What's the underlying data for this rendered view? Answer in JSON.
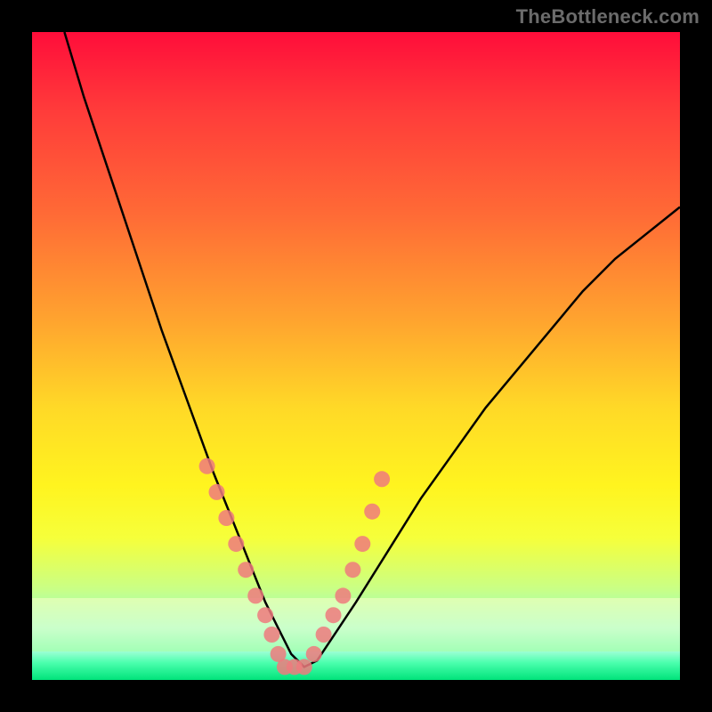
{
  "watermark": "TheBottleneck.com",
  "chart_data": {
    "type": "line",
    "title": "",
    "xlabel": "",
    "ylabel": "",
    "xlim": [
      0,
      100
    ],
    "ylim": [
      0,
      100
    ],
    "grid": false,
    "legend": false,
    "curve_color": "#000000",
    "marker_color": "#ee7a7e",
    "series": [
      {
        "name": "bottleneck-curve",
        "x": [
          5,
          8,
          12,
          16,
          20,
          24,
          28,
          30,
          32,
          34,
          36,
          38,
          40,
          42,
          44,
          46,
          50,
          55,
          60,
          65,
          70,
          75,
          80,
          85,
          90,
          95,
          100
        ],
        "y": [
          100,
          90,
          78,
          66,
          54,
          43,
          32,
          27,
          22,
          17,
          12,
          8,
          4,
          2,
          3,
          6,
          12,
          20,
          28,
          35,
          42,
          48,
          54,
          60,
          65,
          69,
          73
        ]
      }
    ],
    "markers": {
      "name": "sample-points",
      "x": [
        27,
        28.5,
        30,
        31.5,
        33,
        34.5,
        36,
        37,
        38,
        39,
        40.5,
        42,
        43.5,
        45,
        46.5,
        48,
        49.5,
        51,
        52.5,
        54
      ],
      "y": [
        33,
        29,
        25,
        21,
        17,
        13,
        10,
        7,
        4,
        2,
        2,
        2,
        4,
        7,
        10,
        13,
        17,
        21,
        26,
        31
      ]
    },
    "background": {
      "type": "vertical-gradient",
      "top_color": "#ff0d3a",
      "bottom_color": "#00e37a",
      "note": "red-orange-yellow-green heatmap gradient"
    }
  }
}
